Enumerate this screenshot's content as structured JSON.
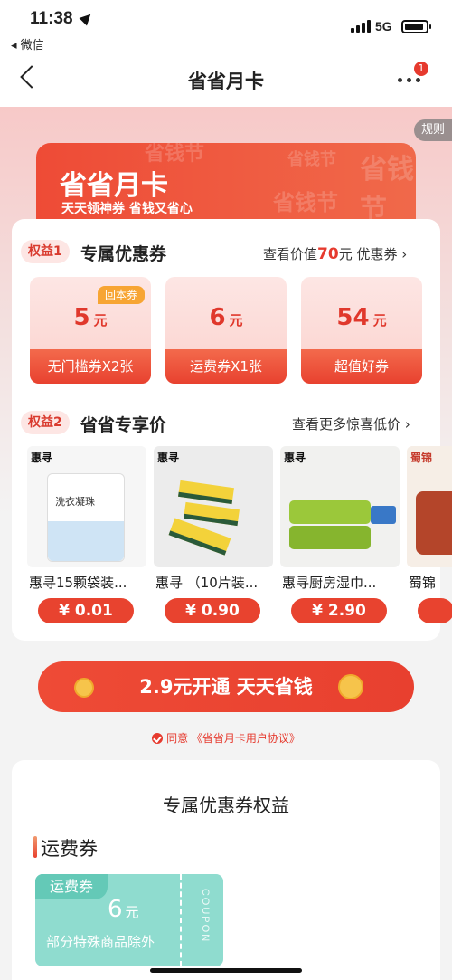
{
  "status": {
    "time": "11:38",
    "back_app": "◂ 微信",
    "network": "5G"
  },
  "nav": {
    "title": "省省月卡",
    "badge": "1"
  },
  "rule_label": "规则",
  "hero": {
    "title": "省省月卡",
    "subtitle": "天天领神券 省钱又省心",
    "watermark": "省钱节"
  },
  "benefit1": {
    "tag": "权益1",
    "title": "专属优惠券",
    "link_prefix": "查看价值",
    "link_value": "70",
    "link_suffix": "元 优惠券 ›",
    "coupons": [
      {
        "value": "5",
        "unit": "元",
        "desc": "无门槛券X2张",
        "label": "回本券"
      },
      {
        "value": "6",
        "unit": "元",
        "desc": "运费券X1张"
      },
      {
        "value": "54",
        "unit": "元",
        "desc": "超值好券"
      }
    ]
  },
  "benefit2": {
    "tag": "权益2",
    "title": "省省专享价",
    "link": "查看更多惊喜低价 ›",
    "products": [
      {
        "logo": "惠寻",
        "name": "惠寻15颗袋装...",
        "price": "¥ 0.01",
        "img_text": "洗衣凝珠"
      },
      {
        "logo": "惠寻",
        "name": "惠寻 （10片装...",
        "price": "¥ 0.90"
      },
      {
        "logo": "惠寻",
        "name": "惠寻厨房湿巾...",
        "price": "¥ 2.90"
      },
      {
        "logo": "蜀锦",
        "name": "蜀锦",
        "price": ""
      }
    ]
  },
  "open_button": "2.9元开通 天天省钱",
  "agreement": "同意 《省省月卡用户协议》",
  "benefits_section": {
    "title": "专属优惠券权益",
    "subtitle": "运费券",
    "freight": {
      "tag": "运费券",
      "value": "6",
      "unit": "元",
      "note": "部分特殊商品除外",
      "side": "COUPON"
    }
  },
  "colors": {
    "accent": "#e8432f",
    "teal": "#8fdccf"
  }
}
